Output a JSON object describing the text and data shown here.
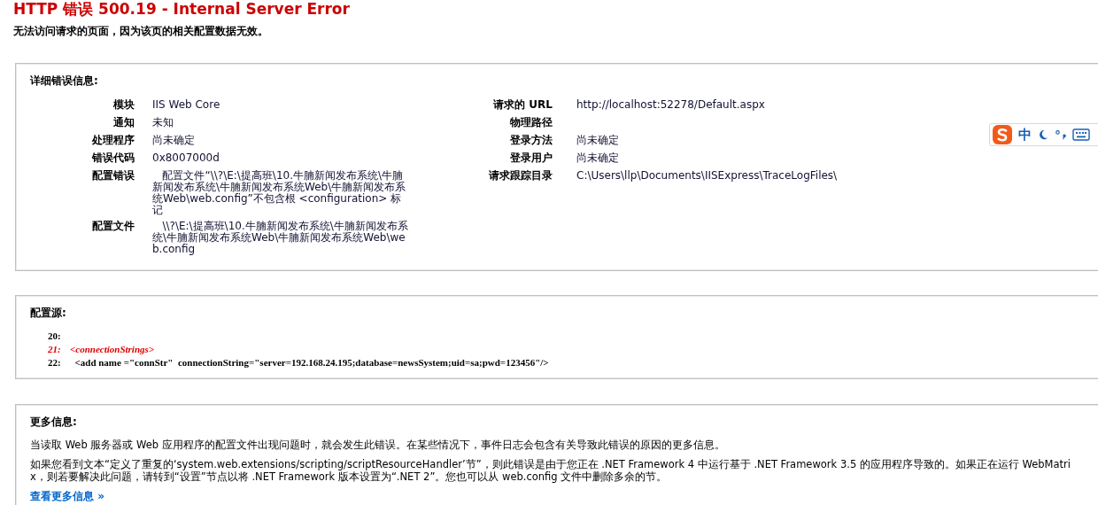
{
  "title": "HTTP 错误 500.19 - Internal Server Error",
  "subtitle": "无法访问请求的页面，因为该页的相关配置数据无效。",
  "details": {
    "heading": "详细错误信息:",
    "left": [
      {
        "label": "模块",
        "value": "IIS Web Core"
      },
      {
        "label": "通知",
        "value": "未知"
      },
      {
        "label": "处理程序",
        "value": "尚未确定"
      },
      {
        "label": "错误代码",
        "value": "0x8007000d"
      },
      {
        "label": "配置错误",
        "value": "   配置文件“\\\\?\\E:\\提高班\\10.牛腩新闻发布系统\\牛腩新闻发布系统\\牛腩新闻发布系统Web\\牛腩新闻发布系统Web\\web.config”不包含根 <configuration> 标记"
      },
      {
        "label": "配置文件",
        "value": "   \\\\?\\E:\\提高班\\10.牛腩新闻发布系统\\牛腩新闻发布系统\\牛腩新闻发布系统Web\\牛腩新闻发布系统Web\\web.config"
      }
    ],
    "right": [
      {
        "label": "请求的 URL",
        "value": "http://localhost:52278/Default.aspx"
      },
      {
        "label": "物理路径"
      },
      {
        "label": "登录方法",
        "value": "尚未确定"
      },
      {
        "label": "登录用户",
        "value": "尚未确定"
      },
      {
        "label": "请求跟踪目录",
        "value": "C:\\Users\\llp\\Documents\\IISExpress\\TraceLogFiles\\"
      }
    ]
  },
  "config_source": {
    "heading": "配置源:",
    "lines": [
      {
        "number": "20:",
        "highlighted": false
      },
      {
        "number": "21:",
        "text": "<connectionStrings>",
        "highlighted": true
      },
      {
        "number": "22:",
        "text": "  <add name =\"connStr\"  connectionString=\"server=192.168.24.195;database=newsSystem;uid=sa;pwd=123456\"/>",
        "highlighted": false
      }
    ]
  },
  "more_info": {
    "heading": "更多信息:",
    "paragraphs": [
      "当读取 Web 服务器或 Web 应用程序的配置文件出现问题时，就会发生此错误。在某些情况下，事件日志会包含有关导致此错误的原因的更多信息。",
      "如果您看到文本“定义了重复的‘system.web.extensions/scripting/scriptResourceHandler’节”，则此错误是由于您正在 .NET Framework 4 中运行基于 .NET Framework 3.5 的应用程序导致的。如果正在运行 WebMatrix，则若要解决此问题，请转到“设置”节点以将 .NET Framework 版本设置为“.NET 2”。您也可以从 web.config 文件中删除多余的节。"
    ],
    "link": "查看更多信息 »"
  },
  "ime_toolbar": {
    "mode": "中"
  }
}
